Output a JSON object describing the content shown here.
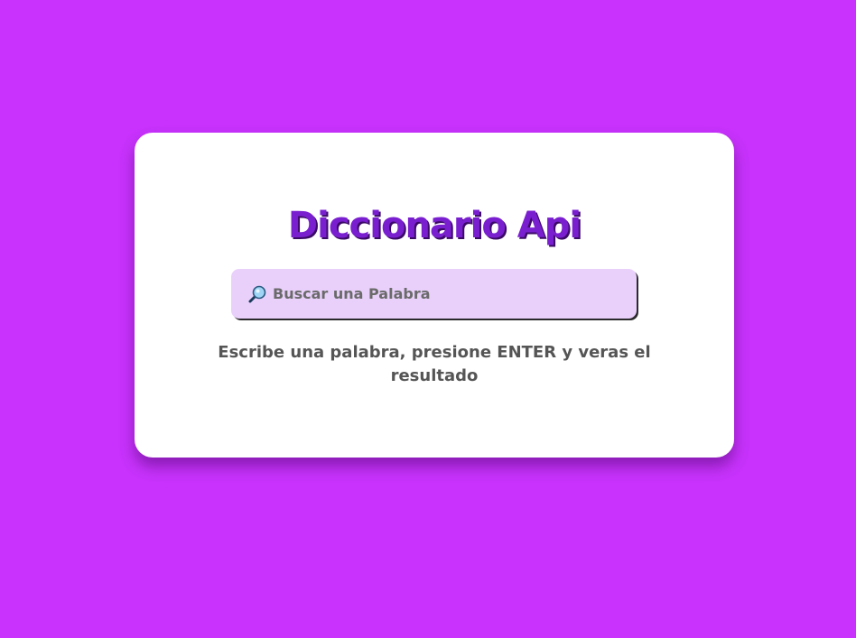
{
  "app": {
    "title": "Diccionario Api"
  },
  "search": {
    "icon": "magnifier-icon",
    "placeholder": "Buscar una Palabra",
    "value": ""
  },
  "hint": {
    "text": "Escribe una palabra, presione ENTER y veras el resultado"
  },
  "colors": {
    "background": "#c832fc",
    "card": "#ffffff",
    "title": "#7a1fd0",
    "input_bg": "#e9d0fb",
    "hint_text": "#555555"
  }
}
